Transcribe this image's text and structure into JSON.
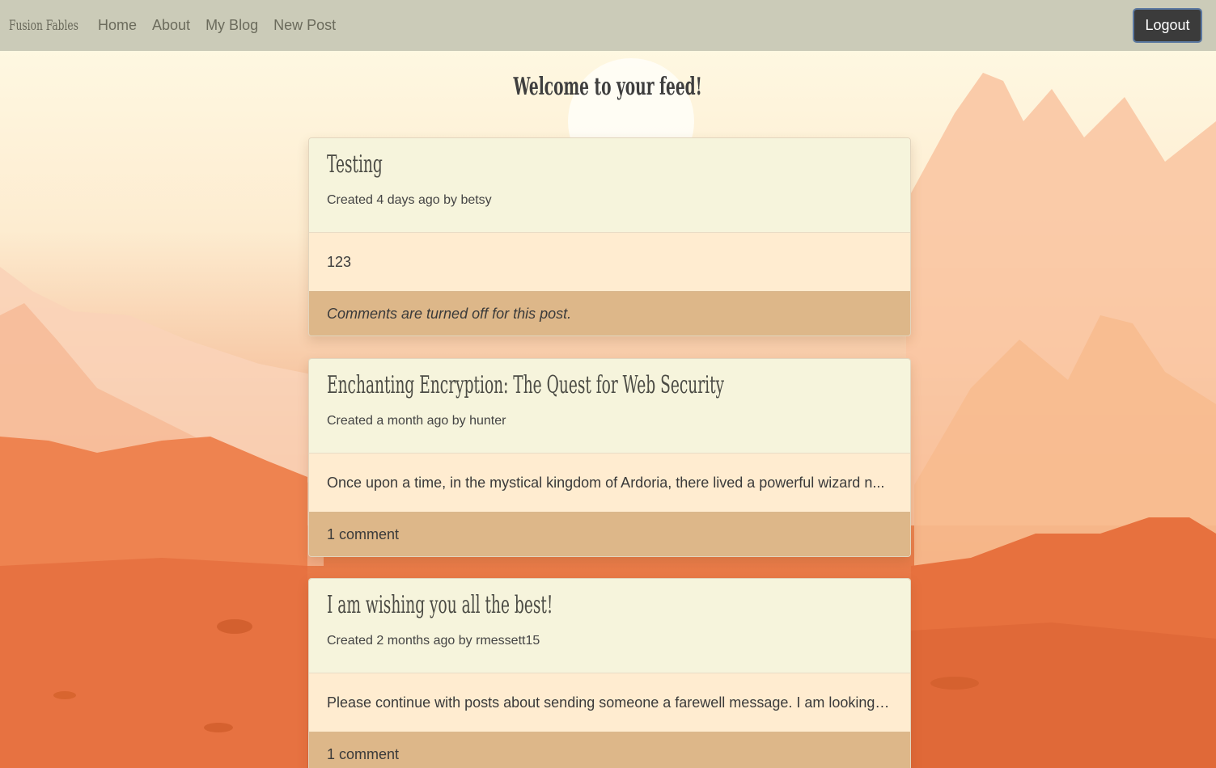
{
  "navbar": {
    "brand": "Fusion Fables",
    "links": [
      "Home",
      "About",
      "My Blog",
      "New Post"
    ],
    "logout_label": "Logout"
  },
  "feed": {
    "title": "Welcome to your feed!",
    "posts": [
      {
        "title": "Testing",
        "meta": "Created 4 days ago by betsy",
        "excerpt": "123",
        "footer": "Comments are turned off for this post."
      },
      {
        "title": "Enchanting Encryption: The Quest for Web Security",
        "meta": "Created a month ago by hunter",
        "excerpt": "Once upon a time, in the mystical kingdom of Ardoria, there lived a powerful wizard n...",
        "footer": "1 comment"
      },
      {
        "title": "I am wishing you all the best!",
        "meta": "Created 2 months ago by rmessett15",
        "excerpt": "Please continue with posts about sending someone a farewell message. I am looking f...",
        "footer": "1 comment"
      }
    ]
  },
  "colors": {
    "navbar_bg": "#cbcbb8",
    "card_header_bg": "#f6f4dc",
    "card_body_bg": "#ffecd0",
    "card_footer_bg": "#ddb789",
    "logout_bg": "#3b3b3b"
  }
}
